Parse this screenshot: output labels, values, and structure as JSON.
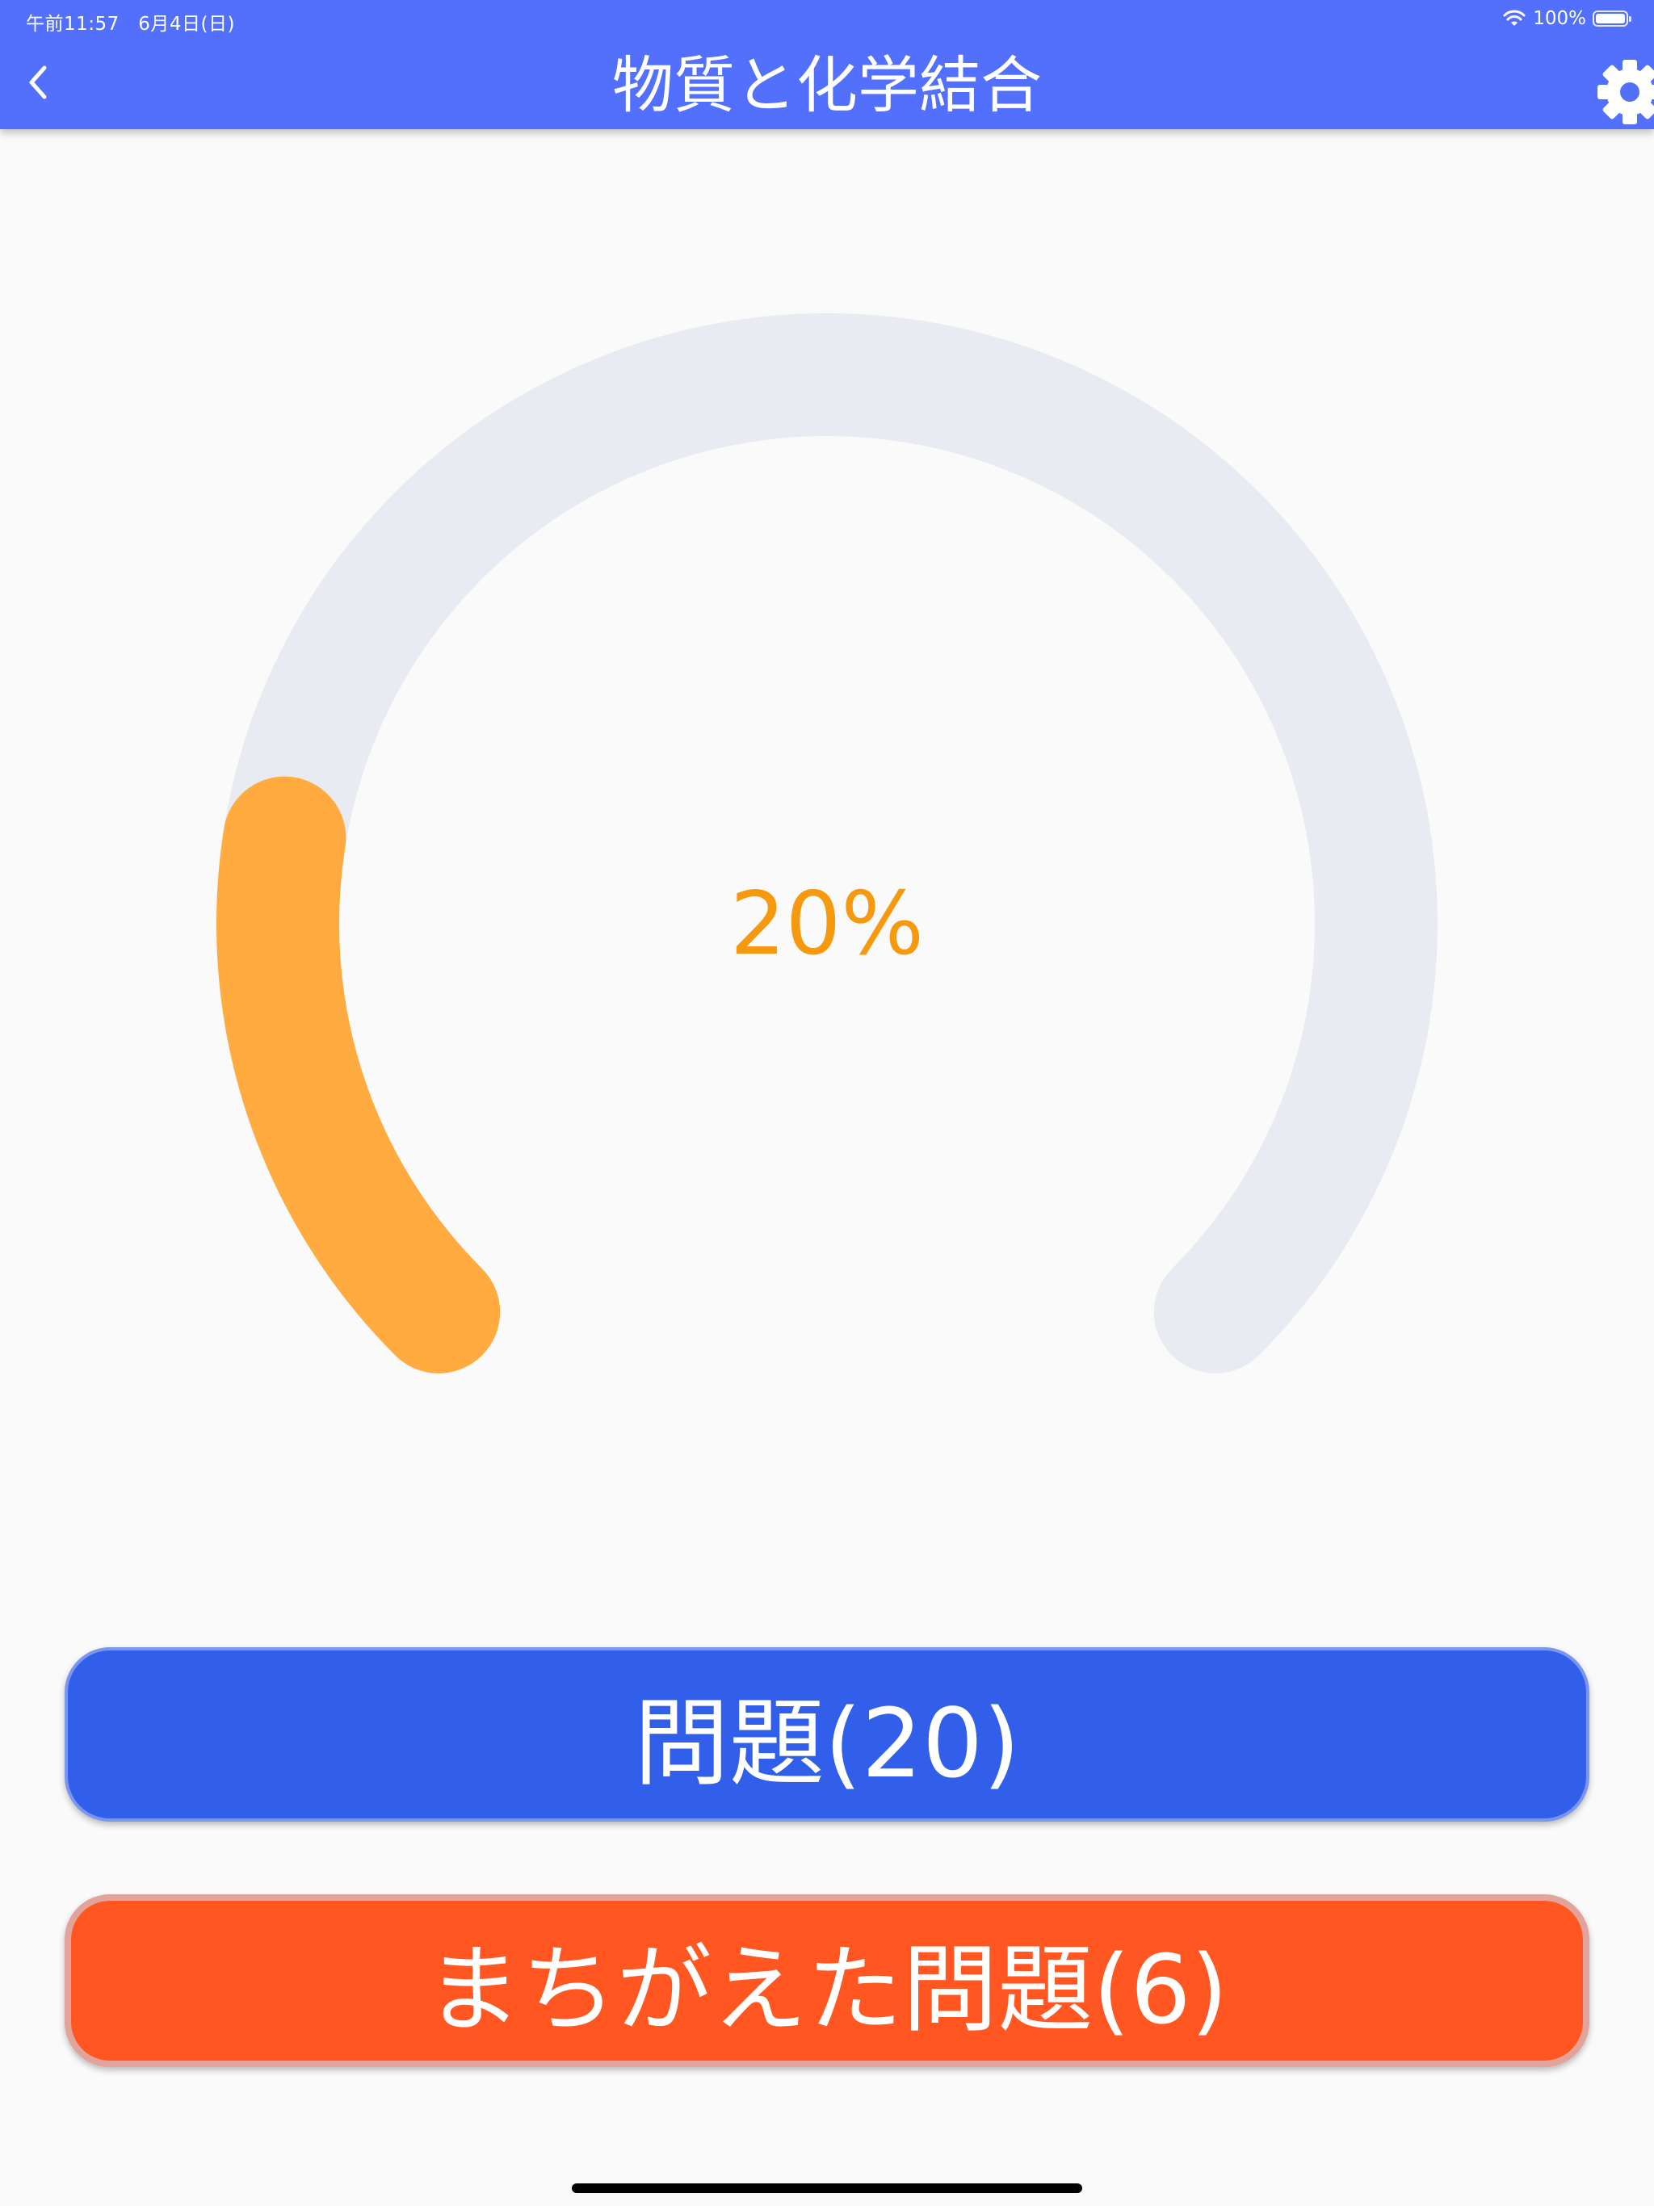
{
  "status_bar": {
    "time_date": "午前11:57　6月4日(日)",
    "battery": "100%"
  },
  "header": {
    "title": "物質と化学結合"
  },
  "progress": {
    "percent_label": "20%",
    "value": 0.2
  },
  "buttons": {
    "questions_label": "問題(20)",
    "wrong_label": "まちがえた問題(6)"
  },
  "colors": {
    "appbar": "#5370fd",
    "gauge_track": "#e8ebf2",
    "gauge_fill": "#ffab40",
    "percent_text": "#f7990f",
    "questions_button": "#315fea",
    "wrong_button": "#ff5622"
  },
  "icons": {
    "back": "chevron-left-icon",
    "settings": "gear-icon",
    "wifi": "wifi-icon",
    "battery": "battery-icon"
  }
}
